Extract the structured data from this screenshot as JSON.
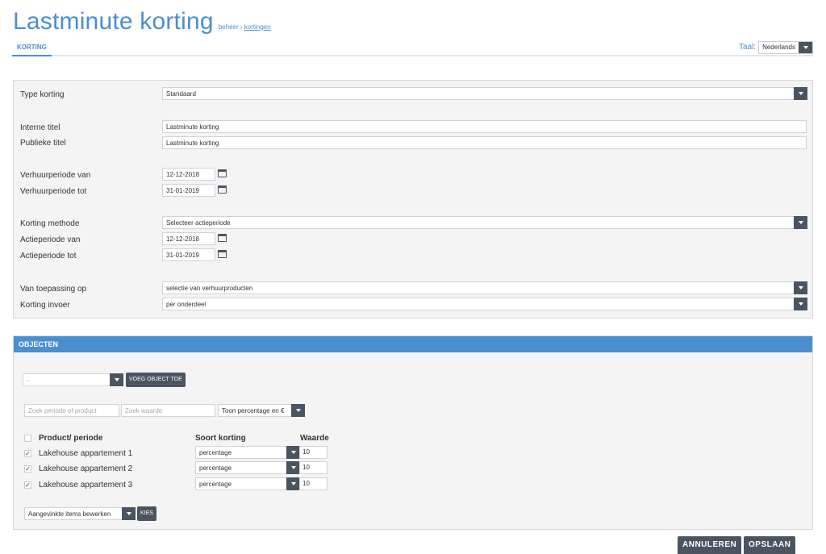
{
  "header": {
    "title": "Lastminute korting",
    "breadcrumb_root": "beheer",
    "breadcrumb_sep": "›",
    "breadcrumb_current": "kortingen"
  },
  "tabs": [
    {
      "label": "KORTING",
      "active": true
    }
  ],
  "language": {
    "label": "Taal:",
    "value": "Nederlands"
  },
  "form": {
    "type_korting": {
      "label": "Type korting",
      "value": "Standaard"
    },
    "interne_titel": {
      "label": "Interne titel",
      "value": "Lastminute korting"
    },
    "publieke_titel": {
      "label": "Publieke titel",
      "value": "Lastminute korting"
    },
    "verhuur_van": {
      "label": "Verhuurperiode van",
      "value": "12-12-2018"
    },
    "verhuur_tot": {
      "label": "Verhuurperiode tot",
      "value": "31-01-2019"
    },
    "korting_methode": {
      "label": "Korting methode",
      "value": "Selecteer actieperiode"
    },
    "actie_van": {
      "label": "Actieperiode van",
      "value": "12-12-2018"
    },
    "actie_tot": {
      "label": "Actieperiode tot",
      "value": "31-01-2019"
    },
    "toepassing": {
      "label": "Van toepassing op",
      "value": "selectie van verhuurproducten"
    },
    "invoer": {
      "label": "Korting invoer",
      "value": "per onderdeel"
    }
  },
  "objecten": {
    "title": "OBJECTEN",
    "object_select": "-",
    "add_button": "VOEG OBJECT TOE",
    "search_period_placeholder": "Zoek periode of product",
    "search_value_placeholder": "Zoek waarde",
    "display_select": "Toon percentage en €",
    "columns": {
      "product": "Product/ periode",
      "soort": "Soort korting",
      "waarde": "Waarde"
    },
    "rows": [
      {
        "name": "Lakehouse appartement 1",
        "type": "percentage",
        "value": "10",
        "checked": true
      },
      {
        "name": "Lakehouse appartement 2",
        "type": "percentage",
        "value": "10",
        "checked": true
      },
      {
        "name": "Lakehouse appartement 3",
        "type": "percentage",
        "value": "10",
        "checked": true
      }
    ],
    "bulk_select": "Aangevinkte items bewerken",
    "bulk_button": "KIES"
  },
  "footer": {
    "cancel": "ANNULEREN",
    "save": "OPSLAAN"
  },
  "icons": {
    "calendar": "calendar-icon",
    "caret": "chevron-down-icon",
    "check": "check-icon"
  },
  "colors": {
    "accent": "#4a8fd0",
    "dark": "#4a5561",
    "panel": "#f4f4f4"
  }
}
